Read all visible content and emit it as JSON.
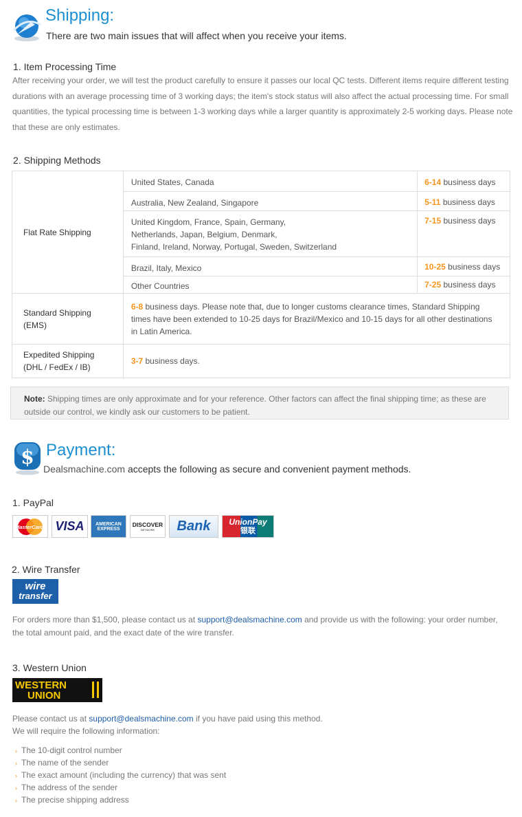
{
  "shipping": {
    "title": "Shipping:",
    "intro": "There are two main issues that will affect when you receive your items.",
    "processing_heading": "1. Item Processing Time",
    "processing_lines": [
      "After receiving your order, we will test the product carefully to ensure it passes our local QC tests. Different items require different testing",
      "durations with an average processing time of 3 working days; the item's stock status will also affect the actual processing time. For small",
      "quantities, the typical processing time is between 1-3 working days while a larger quantity is approximately 2-5 working days. Please note",
      "that these are only estimates."
    ],
    "methods_heading": "2. Shipping Methods",
    "flat_rate_label": "Flat Rate Shipping",
    "flat_rows": [
      {
        "dest": "United States, Canada",
        "days": "6-14",
        "unit": " business days"
      },
      {
        "dest": "Australia, New Zealand, Singapore",
        "days": "5-11",
        "unit": " business days"
      },
      {
        "dest_lines": [
          "United Kingdom, France, Spain, Germany,",
          "Netherlands, Japan, Belgium, Denmark,",
          "Finland, Ireland, Norway, Portugal, Sweden, Switzerland"
        ],
        "days": "7-15",
        "unit": " business days"
      },
      {
        "dest": "Brazil, Italy, Mexico",
        "days": "10-25",
        "unit": " business days"
      },
      {
        "dest": "Other Countries",
        "days": "7-25",
        "unit": " business days"
      }
    ],
    "standard_label_1": "Standard Shipping",
    "standard_label_2": "(EMS)",
    "standard_days": "6-8",
    "standard_text_1": " business days. Please note that, due to longer customs clearance times, Standard Shipping",
    "standard_text_2": "times have been extended to 10-25 days for Brazil/Mexico and 10-15 days for all other destinations",
    "standard_text_3": "in Latin America.",
    "expedited_label_1": "Expedited Shipping",
    "expedited_label_2": "(DHL / FedEx / IB)",
    "expedited_days": "3-7",
    "expedited_text": " business days.",
    "note_label": "Note:",
    "note_text_1": " Shipping times are only approximate and for your reference. Other factors can affect the final shipping time; as these are",
    "note_text_2": "outside our control, we kindly ask our customers to be patient."
  },
  "payment": {
    "title": "Payment:",
    "brand": "Dealsmachine.com",
    "intro": " accepts the following as secure and convenient payment methods.",
    "paypal_heading": "1. PayPal",
    "card_logos": {
      "mastercard": "MasterCard",
      "visa": "VISA",
      "amex_1": "AMERICAN",
      "amex_2": "EXPRESS",
      "discover": "DISCOVER",
      "discover_sub": "NETWORK",
      "bank": "Bank",
      "unionpay": "UnionPay",
      "unionpay_cn": "银联"
    },
    "wire_heading": "2. Wire Transfer",
    "wire_logo_1": "wire",
    "wire_logo_2": "transfer",
    "wire_text_1a": "For orders more than $1,500, please contact us at ",
    "wire_email": "support@dealsmachine.com",
    "wire_text_1b": " and provide us with the following: your order number,",
    "wire_text_2": "the total amount paid, and the exact date of the wire transfer.",
    "wu_heading": "3. Western Union",
    "wu_logo_1": "WESTERN",
    "wu_logo_2": "UNION",
    "wu_text_1a": "Please contact us at ",
    "wu_email": "support@dealsmachine.com",
    "wu_text_1b": " if you have paid using this method.",
    "wu_text_2": "We will require the following information:",
    "wu_items": [
      "The 10-digit control number",
      "The name of the sender",
      "The exact amount (including the currency) that was sent",
      "The address of the sender",
      "The precise shipping address"
    ]
  },
  "colors": {
    "accent": "#1c8fd3",
    "orange": "#f7941d",
    "link": "#1f5ea8"
  }
}
